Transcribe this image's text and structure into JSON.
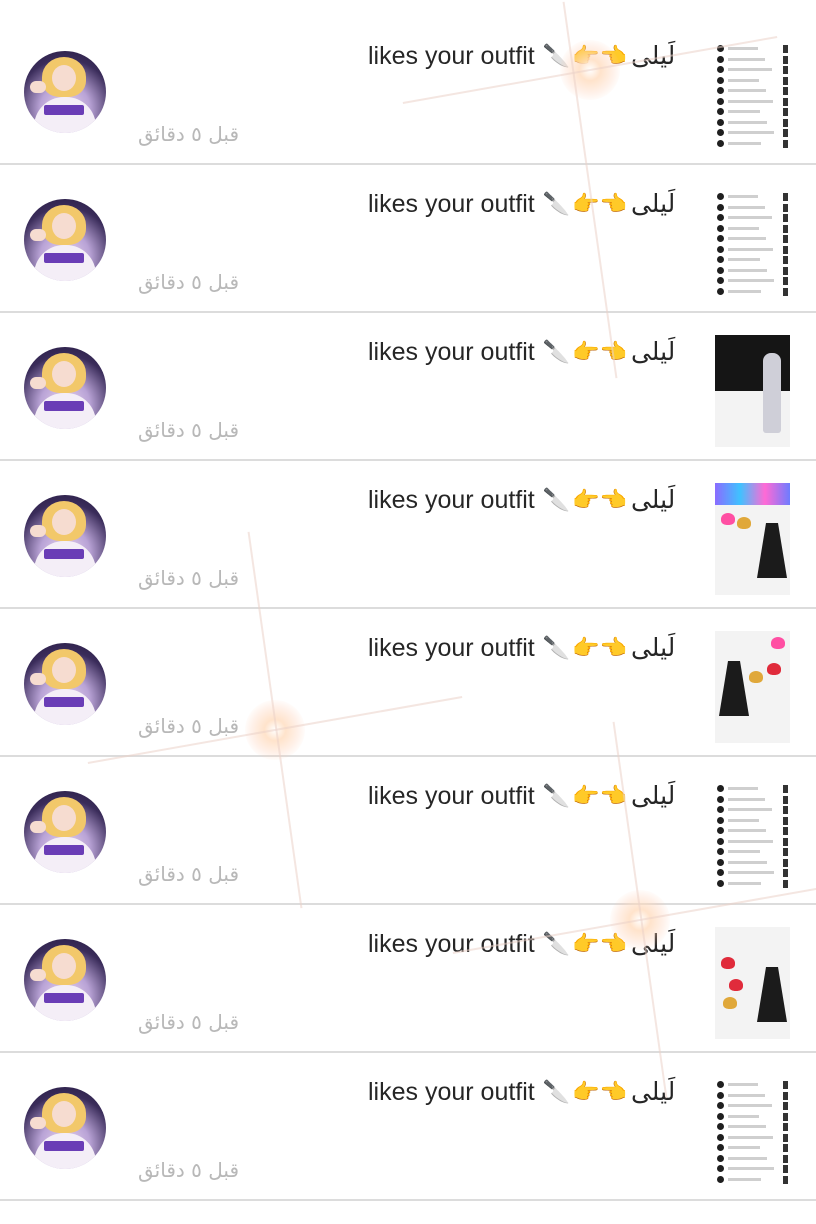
{
  "notifications": [
    {
      "action": "likes your outfit",
      "knife": "🔪",
      "hands": "👉👈",
      "user": "لَيلى",
      "time": "قبل ٥ دقائق",
      "thumb": "chat"
    },
    {
      "action": "likes your outfit",
      "knife": "🔪",
      "hands": "👉👈",
      "user": "لَيلى",
      "time": "قبل ٥ دقائق",
      "thumb": "chat"
    },
    {
      "action": "likes your outfit",
      "knife": "🔪",
      "hands": "👉👈",
      "user": "لَيلى",
      "time": "قبل ٥ دقائق",
      "thumb": "outfit-paris"
    },
    {
      "action": "likes your outfit",
      "knife": "🔪",
      "hands": "👉👈",
      "user": "لَيلى",
      "time": "قبل ٥ دقائق",
      "thumb": "outfit-drip"
    },
    {
      "action": "likes your outfit",
      "knife": "🔪",
      "hands": "👉👈",
      "user": "لَيلى",
      "time": "قبل ٥ دقائق",
      "thumb": "outfit-hearts"
    },
    {
      "action": "likes your outfit",
      "knife": "🔪",
      "hands": "👉👈",
      "user": "لَيلى",
      "time": "قبل ٥ دقائق",
      "thumb": "chat"
    },
    {
      "action": "likes your outfit",
      "knife": "🔪",
      "hands": "👉👈",
      "user": "لَيلى",
      "time": "قبل ٥ دقائق",
      "thumb": "outfit-love"
    },
    {
      "action": "likes your outfit",
      "knife": "🔪",
      "hands": "👉👈",
      "user": "لَيلى",
      "time": "قبل ٥ دقائق",
      "thumb": "chat"
    }
  ],
  "icons": {
    "knife": "knife-icon",
    "hands": "pointing-hands-icon"
  }
}
